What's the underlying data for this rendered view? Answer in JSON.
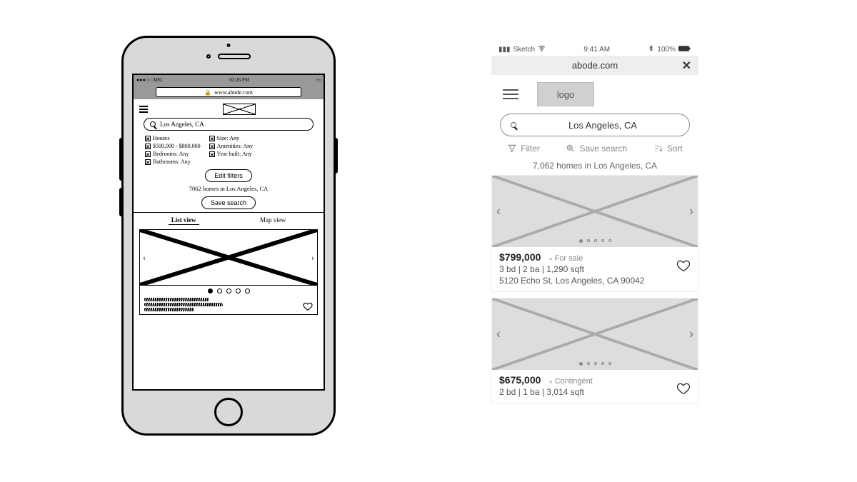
{
  "left": {
    "status": {
      "carrier": "●●●○○ ABC",
      "time": "02:26 PM"
    },
    "url": "www.abode.com",
    "search": "Los Angeles, CA",
    "filters_col1": [
      "Houses",
      "$500,000 - $800,000",
      "Bedrooms: Any",
      "Bathrooms: Any"
    ],
    "filters_col2": [
      "Size: Any",
      "Amenities: Any",
      "Year built: Any"
    ],
    "edit_btn": "Edit filters",
    "count": "7062 homes in Los Angeles, CA",
    "save_btn": "Save search",
    "tabs": {
      "list": "List view",
      "map": "Map view"
    }
  },
  "right": {
    "status": {
      "left": "Sketch",
      "time": "9:41 AM",
      "right": "100%"
    },
    "url": "abode.com",
    "logo": "logo",
    "search": "Los Angeles, CA",
    "actions": {
      "filter": "Filter",
      "save": "Save search",
      "sort": "Sort"
    },
    "count": "7,062 homes in Los Angeles, CA",
    "listings": [
      {
        "price": "$799,000",
        "status": "For sale",
        "stats": "3 bd | 2 ba | 1,290 sqft",
        "address": "5120 Echo St, Los Angeles, CA 90042"
      },
      {
        "price": "$675,000",
        "status": "Contingent",
        "stats": "2 bd | 1 ba | 3,014 sqft",
        "address": ""
      }
    ]
  }
}
